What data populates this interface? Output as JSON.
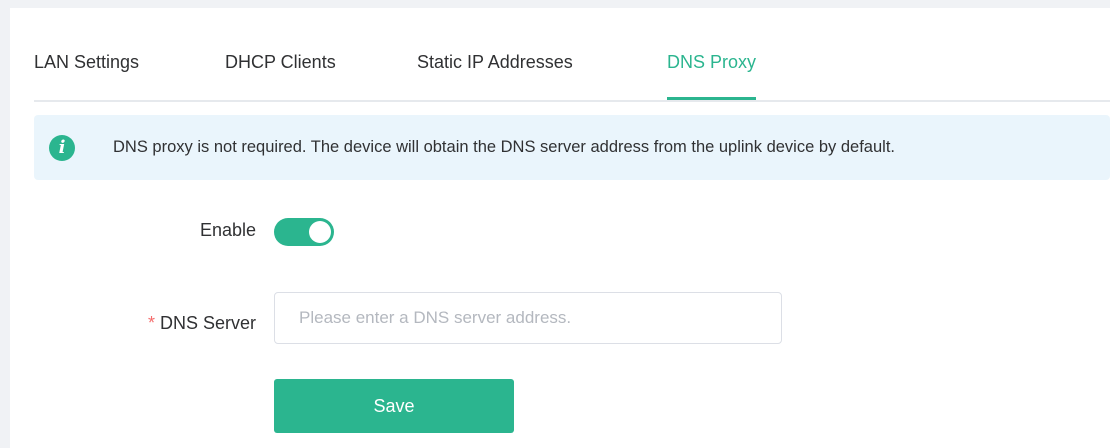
{
  "tabs": [
    {
      "label": "LAN Settings",
      "active": false
    },
    {
      "label": "DHCP Clients",
      "active": false
    },
    {
      "label": "Static IP Addresses",
      "active": false
    },
    {
      "label": "DNS Proxy",
      "active": true
    }
  ],
  "notice": {
    "icon": "info-icon",
    "text": "DNS proxy is not required. The device will obtain the DNS server address from the uplink device by default."
  },
  "form": {
    "enable_label": "Enable",
    "enable_on": true,
    "dns_server_required_mark": "*",
    "dns_server_label": "DNS Server",
    "dns_server_value": "",
    "dns_server_placeholder": "Please enter a DNS server address.",
    "save_label": "Save"
  },
  "colors": {
    "accent": "#2bb58f",
    "notice_bg": "#eaf5fc",
    "required": "#f56c6c"
  }
}
